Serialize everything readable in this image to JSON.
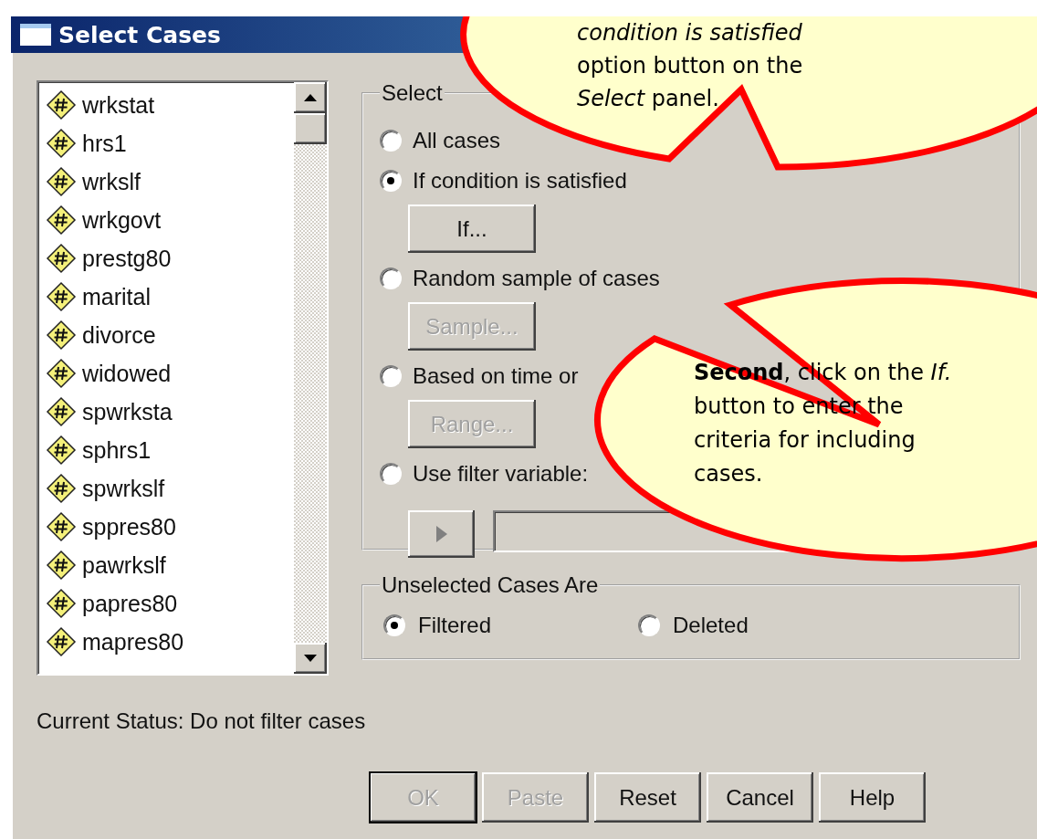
{
  "window": {
    "title": "Select Cases"
  },
  "variables": [
    "wrkstat",
    "hrs1",
    "wrkslf",
    "wrkgovt",
    "prestg80",
    "marital",
    "divorce",
    "widowed",
    "spwrksta",
    "sphrs1",
    "spwrkslf",
    "sppres80",
    "pawrkslf",
    "papres80",
    "mapres80"
  ],
  "select_group": {
    "title": "Select",
    "options": [
      {
        "label": "All cases",
        "selected": false
      },
      {
        "label": "If condition is satisfied",
        "selected": true,
        "button": {
          "label": "If...",
          "disabled": false
        }
      },
      {
        "label": "Random sample of cases",
        "selected": false,
        "button": {
          "label": "Sample...",
          "disabled": true
        }
      },
      {
        "label": "Based on time or",
        "selected": false,
        "button": {
          "label": "Range...",
          "disabled": true
        }
      },
      {
        "label": "Use filter variable:",
        "selected": false
      }
    ]
  },
  "unselected_group": {
    "title": "Unselected Cases Are",
    "options": [
      {
        "label": "Filtered",
        "selected": true
      },
      {
        "label": "Deleted",
        "selected": false
      }
    ]
  },
  "status": "Current Status: Do not filter cases",
  "buttons": [
    {
      "label": "OK",
      "disabled": true,
      "default": true
    },
    {
      "label": "Paste",
      "disabled": true,
      "default": false
    },
    {
      "label": "Reset",
      "disabled": false,
      "default": false
    },
    {
      "label": "Cancel",
      "disabled": false,
      "default": false
    },
    {
      "label": "Help",
      "disabled": false,
      "default": false
    }
  ],
  "callouts": [
    {
      "lines": [
        "*condition is satisfied*",
        "option button on the",
        "*Select* panel."
      ]
    },
    {
      "lines": [
        "**Second**, click on the *If.*",
        "button to enter the",
        "criteria for including",
        "cases."
      ]
    }
  ]
}
